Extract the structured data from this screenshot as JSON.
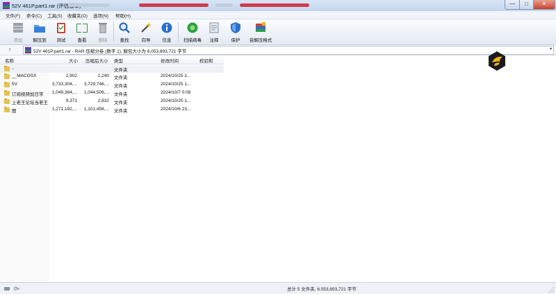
{
  "window": {
    "title": "52V 461P.part1.rar (评估版本)",
    "minimize_symbol": "—",
    "maximize_symbol": "□",
    "close_symbol": "✕"
  },
  "menu": [
    "文件(F)",
    "命令(C)",
    "工具(S)",
    "收藏夹(O)",
    "选项(N)",
    "帮助(H)"
  ],
  "toolbar": {
    "buttons": [
      {
        "label": "添加",
        "icon": "add-archive-icon",
        "enabled": false
      },
      {
        "label": "解压到",
        "icon": "extract-folder-icon",
        "enabled": true
      },
      {
        "label": "测试",
        "icon": "test-clipboard-icon",
        "enabled": true
      },
      {
        "label": "查看",
        "icon": "view-book-icon",
        "enabled": true
      },
      {
        "label": "删除",
        "icon": "trash-icon",
        "enabled": false
      },
      {
        "label": "查找",
        "icon": "magnifier-icon",
        "enabled": true
      },
      {
        "label": "向导",
        "icon": "wand-icon",
        "enabled": true
      },
      {
        "label": "信息",
        "icon": "info-icon",
        "enabled": true
      },
      {
        "label": "扫描病毒",
        "icon": "virus-scan-icon",
        "enabled": true
      },
      {
        "label": "注释",
        "icon": "comment-icon",
        "enabled": true
      },
      {
        "label": "保护",
        "icon": "shield-icon",
        "enabled": true
      },
      {
        "label": "自解压格式",
        "icon": "sfx-icon",
        "enabled": true
      }
    ]
  },
  "address": {
    "up_symbol": "↑",
    "path": "52V 461P.part1.rar - RAR 压缩分卷 (数字 1), 解包大小为 6,053,893,721 字节",
    "dropdown_symbol": "▾"
  },
  "columns": {
    "name": "名称",
    "size": "大小",
    "packed": "压缩后大小",
    "type": "类型",
    "modified": "修改时间",
    "crc": "校验和"
  },
  "rows": [
    {
      "name": "..",
      "size": "",
      "packed": "",
      "type": "文件夹",
      "modified": "",
      "crc": ""
    },
    {
      "name": "__MACOSX",
      "size": "2,902",
      "packed": "2,240",
      "type": "文件夹",
      "modified": "2024/10/25 1...",
      "crc": ""
    },
    {
      "name": "5V",
      "size": "3,733,304,...",
      "packed": "3,729,746,...",
      "type": "文件夹",
      "modified": "2024/10/25 1...",
      "crc": ""
    },
    {
      "name": "订阅视频加日常",
      "size": "1,049,384,...",
      "packed": "1,044,506,...",
      "type": "文件夹",
      "modified": "2024/10/7 0:08",
      "crc": ""
    },
    {
      "name": "上老王论坛当老王",
      "size": "9,371",
      "packed": "2,832",
      "type": "文件夹",
      "modified": "2024/10/25 1...",
      "crc": ""
    },
    {
      "name": "图",
      "size": "1,271,192,...",
      "packed": "1,101,458,...",
      "type": "文件夹",
      "modified": "2024/10/6 23...",
      "crc": ""
    }
  ],
  "status": {
    "text": "总计 5 文件夹, 6,053,893,721 字节"
  },
  "colors": {
    "accent": "#1c6fd1",
    "folder": "#e8c14e",
    "close_button": "#c7432d"
  }
}
